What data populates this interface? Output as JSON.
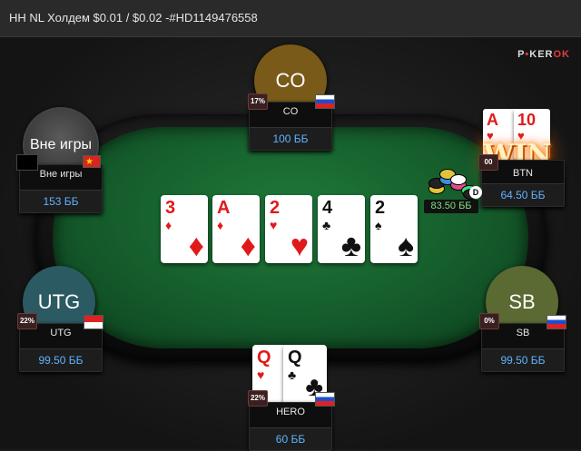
{
  "title": "HH NL Холдем $0.01 / $0.02 -#HD1149476558",
  "logo": {
    "p1": "P",
    "red": "•",
    "p2": "KER",
    "p3": "OK"
  },
  "seats": {
    "co": {
      "avatar": "CO",
      "name": "CO",
      "stack": "100 ББ",
      "pct": "17%",
      "flag": "ru"
    },
    "sitout": {
      "avatar": "Вне игры",
      "name": "Вне игры",
      "stack": "153 ББ",
      "flag": "cn"
    },
    "btn": {
      "name": "BTN",
      "stack": "64.50 ББ",
      "pct": "00",
      "win": "WIN",
      "cards": [
        {
          "rank": "A",
          "suit": "♥"
        },
        {
          "rank": "10",
          "suit": "♥"
        }
      ]
    },
    "utg": {
      "avatar": "UTG",
      "name": "UTG",
      "stack": "99.50 ББ",
      "pct": "22%",
      "flag": "id"
    },
    "sb": {
      "avatar": "SB",
      "name": "SB",
      "stack": "99.50 ББ",
      "pct": "0%",
      "flag": "ru"
    },
    "hero": {
      "name": "HERO",
      "stack": "60 ББ",
      "pct": "22%",
      "flag": "ru",
      "cards": [
        {
          "rank": "Q",
          "suit": "♥"
        },
        {
          "rank": "Q",
          "suit": "♣"
        }
      ]
    }
  },
  "pot": "83.50 ББ",
  "board": [
    {
      "rank": "3",
      "suit": "♦",
      "color": "red"
    },
    {
      "rank": "A",
      "suit": "♦",
      "color": "red"
    },
    {
      "rank": "2",
      "suit": "♥",
      "color": "red"
    },
    {
      "rank": "4",
      "suit": "♣",
      "color": "black"
    },
    {
      "rank": "2",
      "suit": "♠",
      "color": "black"
    }
  ]
}
